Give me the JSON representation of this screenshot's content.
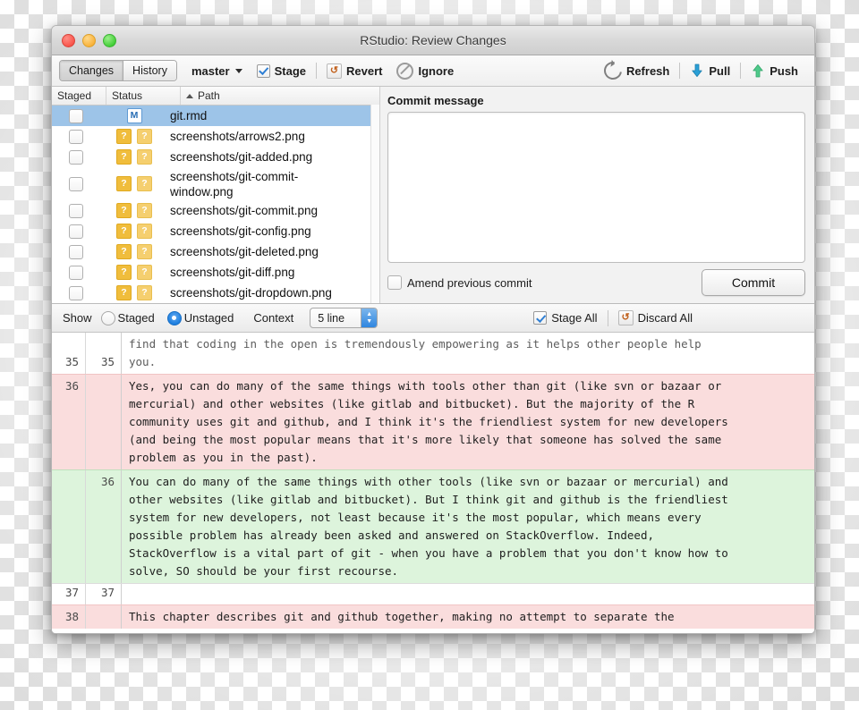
{
  "window": {
    "title": "RStudio: Review Changes",
    "traffic_lights": [
      "close-red",
      "minimize-yellow",
      "zoom-green"
    ]
  },
  "toolbar": {
    "tabs": [
      {
        "label": "Changes",
        "active": true
      },
      {
        "label": "History",
        "active": false
      }
    ],
    "branch": "master",
    "stage_label": "Stage",
    "stage_checked": true,
    "revert_label": "Revert",
    "ignore_label": "Ignore",
    "refresh_label": "Refresh",
    "pull_label": "Pull",
    "push_label": "Push",
    "pull_color": "#2a9fd6",
    "push_color": "#4fc98a"
  },
  "files": {
    "columns": {
      "staged": "Staged",
      "status": "Status",
      "path": "Path",
      "sort_indicator": "ascending"
    },
    "rows": [
      {
        "staged": false,
        "status": [
          "M"
        ],
        "path": "git.rmd",
        "selected": true,
        "wrapped": false
      },
      {
        "staged": false,
        "status": [
          "?",
          "?"
        ],
        "path": "screenshots/arrows2.png",
        "selected": false,
        "wrapped": false
      },
      {
        "staged": false,
        "status": [
          "?",
          "?"
        ],
        "path": "screenshots/git-added.png",
        "selected": false,
        "wrapped": false
      },
      {
        "staged": false,
        "status": [
          "?",
          "?"
        ],
        "path": "screenshots/git-commit-\nwindow.png",
        "selected": false,
        "wrapped": true
      },
      {
        "staged": false,
        "status": [
          "?",
          "?"
        ],
        "path": "screenshots/git-commit.png",
        "selected": false,
        "wrapped": false
      },
      {
        "staged": false,
        "status": [
          "?",
          "?"
        ],
        "path": "screenshots/git-config.png",
        "selected": false,
        "wrapped": false
      },
      {
        "staged": false,
        "status": [
          "?",
          "?"
        ],
        "path": "screenshots/git-deleted.png",
        "selected": false,
        "wrapped": false
      },
      {
        "staged": false,
        "status": [
          "?",
          "?"
        ],
        "path": "screenshots/git-diff.png",
        "selected": false,
        "wrapped": false
      },
      {
        "staged": false,
        "status": [
          "?",
          "?"
        ],
        "path": "screenshots/git-dropdown.png",
        "selected": false,
        "wrapped": false
      }
    ]
  },
  "commit": {
    "label": "Commit message",
    "message_value": "",
    "message_placeholder": "",
    "amend_label": "Amend previous commit",
    "amend_checked": false,
    "commit_button": "Commit"
  },
  "diff_controls": {
    "show_label": "Show",
    "staged_label": "Staged",
    "unstaged_label": "Unstaged",
    "selected": "Unstaged",
    "context_label": "Context",
    "context_value": "5 line",
    "stage_all_label": "Stage All",
    "stage_all_checked": true,
    "discard_all_label": "Discard All"
  },
  "diff": {
    "chunks": [
      {
        "type": "context",
        "old_line": "35",
        "new_line": "35",
        "text": "find that coding in the open is tremendously empowering as it helps other people help\nyou."
      },
      {
        "type": "deletion",
        "old_line": "36",
        "new_line": "",
        "text": "Yes, you can do many of the same things with tools other than git (like svn or bazaar or\nmercurial) and other websites (like gitlab and bitbucket). But the majority of the R\ncommunity uses git and github, and I think it's the friendliest system for new developers\n(and being the most popular means that it's more likely that someone has solved the same\nproblem as you in the past)."
      },
      {
        "type": "addition",
        "old_line": "",
        "new_line": "36",
        "text": "You can do many of the same things with other tools (like svn or bazaar or mercurial) and\nother websites (like gitlab and bitbucket). But I think git and github is the friendliest\nsystem for new developers, not least because it's the most popular, which means every\npossible problem has already been asked and answered on StackOverflow. Indeed,\nStackOverflow is a vital part of git - when you have a problem that you don't know how to\nsolve, SO should be your first recourse."
      },
      {
        "type": "context",
        "old_line": "37",
        "new_line": "37",
        "text": ""
      },
      {
        "type": "deletion",
        "old_line": "38",
        "new_line": "",
        "text": "This chapter describes git and github together, making no attempt to separate the"
      }
    ],
    "colors": {
      "deletion_bg": "#fadddd",
      "addition_bg": "#ddf4dc",
      "context_bg": "#ffffff"
    }
  }
}
